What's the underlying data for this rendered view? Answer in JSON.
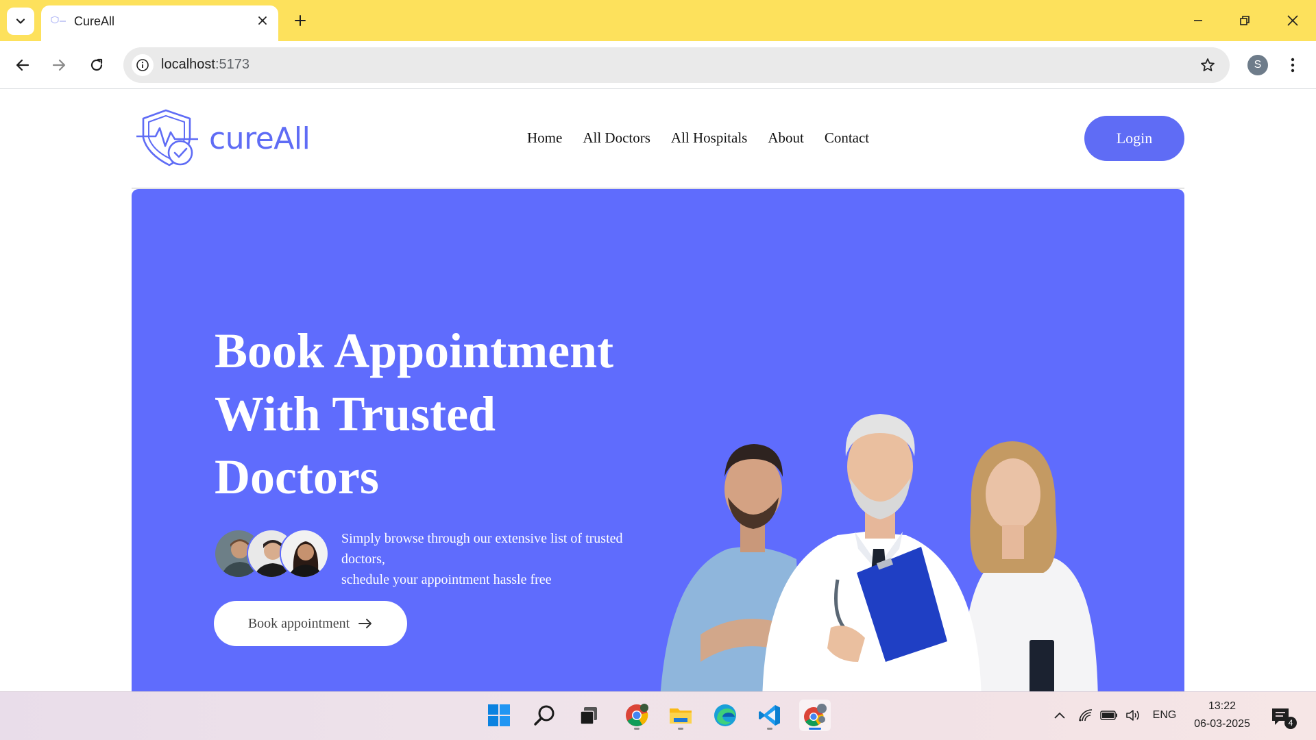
{
  "browser": {
    "tab": {
      "title": "CureAll"
    },
    "url": {
      "host": "localhost",
      "port": ":5173"
    },
    "profile_initial": "S"
  },
  "site": {
    "logo_text": "cureAll",
    "nav": [
      "Home",
      "All Doctors",
      "All Hospitals",
      "About",
      "Contact"
    ],
    "login_label": "Login",
    "brand_color": "#5f6cf5"
  },
  "hero": {
    "title_lines": [
      "Book Appointment",
      "With Trusted",
      "Doctors"
    ],
    "description_lines": [
      "Simply browse through our extensive list of trusted",
      "doctors,",
      "schedule your appointment hassle free"
    ],
    "button_label": "Book appointment",
    "background_color": "#5f6cfd"
  },
  "taskbar": {
    "icons": [
      "windows-start-icon",
      "search-icon",
      "task-view-icon",
      "chrome-icon",
      "file-explorer-icon",
      "edge-icon",
      "vscode-icon",
      "chrome-profile-icon"
    ],
    "language": "ENG",
    "time": "13:22",
    "date": "06-03-2025",
    "notification_count": "4"
  }
}
